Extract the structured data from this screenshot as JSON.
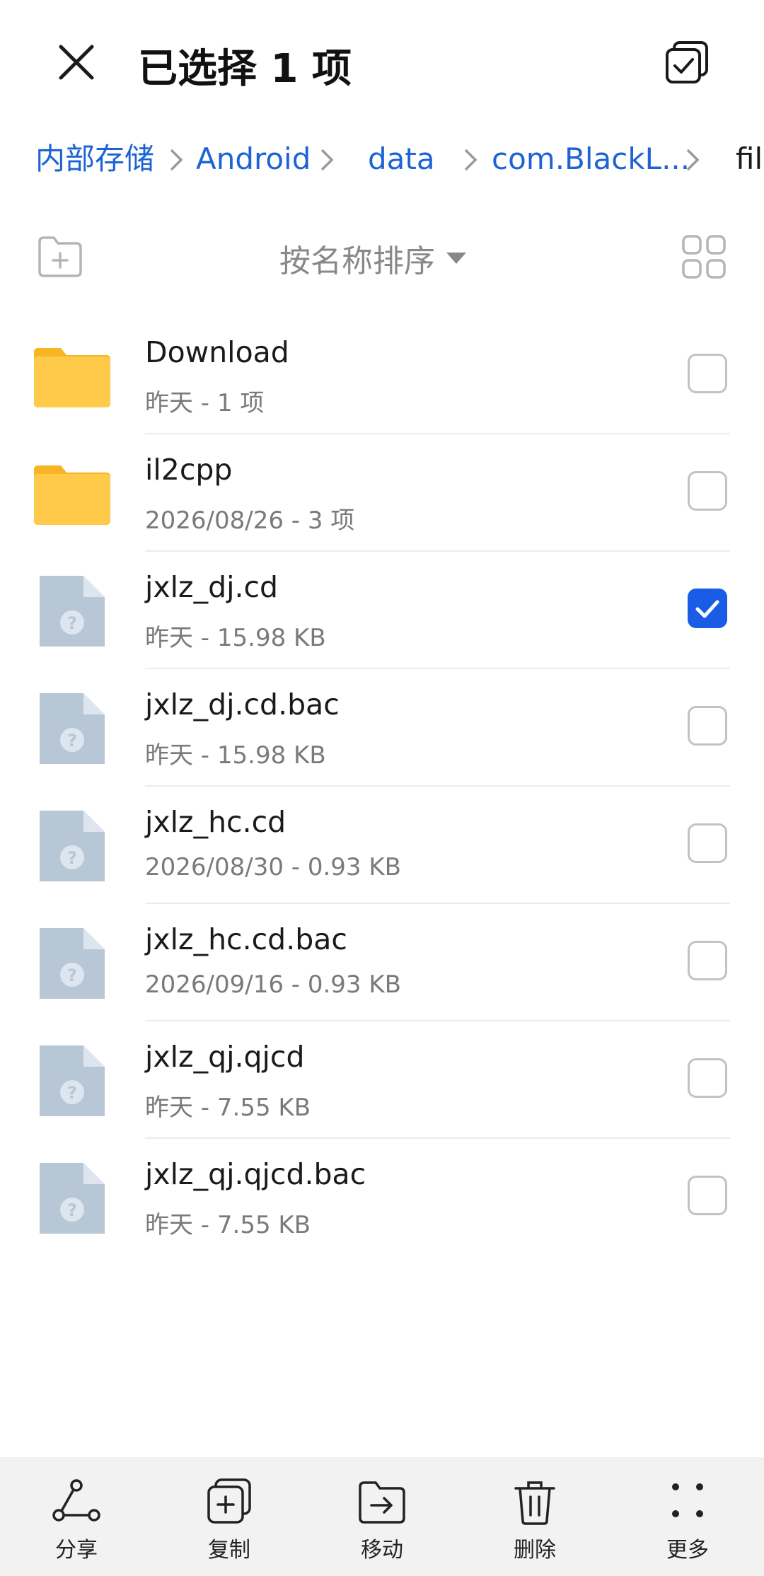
{
  "header": {
    "title": "已选择 1 项",
    "close_icon": "close-icon",
    "select_all_icon": "select-all-icon"
  },
  "breadcrumb": [
    {
      "label": "内部存储"
    },
    {
      "label": "Android"
    },
    {
      "label": "data"
    },
    {
      "label": "com.BlackL..."
    },
    {
      "label": "file"
    }
  ],
  "toolbar": {
    "sort_label": "按名称排序",
    "new_folder_icon": "new-folder-icon",
    "grid_view_icon": "grid-view-icon"
  },
  "files": [
    {
      "name": "Download",
      "meta": "昨天 - 1 项",
      "type": "folder",
      "checked": false
    },
    {
      "name": "il2cpp",
      "meta": "2026/08/26 - 3 项",
      "type": "folder",
      "checked": false
    },
    {
      "name": "jxlz_dj.cd",
      "meta": "昨天 - 15.98 KB",
      "type": "unknown-file",
      "checked": true
    },
    {
      "name": "jxlz_dj.cd.bac",
      "meta": "昨天 - 15.98 KB",
      "type": "unknown-file",
      "checked": false
    },
    {
      "name": "jxlz_hc.cd",
      "meta": "2026/08/30 - 0.93 KB",
      "type": "unknown-file",
      "checked": false
    },
    {
      "name": "jxlz_hc.cd.bac",
      "meta": "2026/09/16 - 0.93 KB",
      "type": "unknown-file",
      "checked": false
    },
    {
      "name": "jxlz_qj.qjcd",
      "meta": "昨天 - 7.55 KB",
      "type": "unknown-file",
      "checked": false
    },
    {
      "name": "jxlz_qj.qjcd.bac",
      "meta": "昨天 - 7.55 KB",
      "type": "unknown-file",
      "checked": false
    }
  ],
  "bottom_actions": [
    {
      "label": "分享",
      "icon": "share-icon"
    },
    {
      "label": "复制",
      "icon": "copy-icon"
    },
    {
      "label": "移动",
      "icon": "move-icon"
    },
    {
      "label": "删除",
      "icon": "delete-icon"
    },
    {
      "label": "更多",
      "icon": "more-icon"
    }
  ],
  "colors": {
    "accent": "#1a5ce6",
    "link": "#1e63d6",
    "folder": "#ffc94a",
    "unknown_file": "#b7c7d5"
  }
}
